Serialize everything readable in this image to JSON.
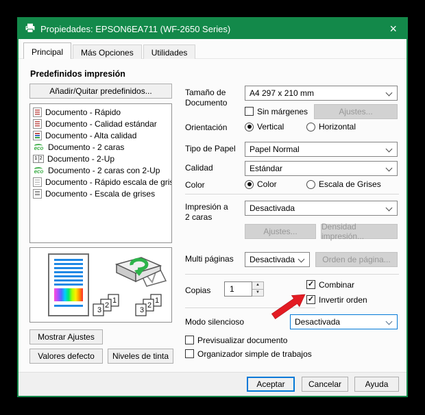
{
  "window": {
    "title": "Propiedades: EPSON6EA711 (WF-2650 Series)",
    "close_glyph": "×"
  },
  "tabs": [
    {
      "label": "Principal",
      "active": true
    },
    {
      "label": "Más Opciones",
      "active": false
    },
    {
      "label": "Utilidades",
      "active": false
    }
  ],
  "presets": {
    "heading": "Predefinidos impresión",
    "add_remove": "Añadir/Quitar predefinidos...",
    "items": [
      {
        "icon": "document-color-icon",
        "label": "Documento - Rápido"
      },
      {
        "icon": "document-color-icon",
        "label": "Documento - Calidad estándar"
      },
      {
        "icon": "document-multicolor-icon",
        "label": "Documento - Alta calidad"
      },
      {
        "icon": "eco-icon",
        "label": "Documento - 2 caras"
      },
      {
        "icon": "two-up-icon",
        "label": "Documento - 2-Up"
      },
      {
        "icon": "eco-icon",
        "label": "Documento - 2 caras con 2-Up"
      },
      {
        "icon": "document-gray-icon",
        "label": "Documento - Rápido escala de grises"
      },
      {
        "icon": "document-gray-icon",
        "label": "Documento - Escala de grises"
      }
    ],
    "show_settings": "Mostrar Ajustes",
    "defaults": "Valores defecto",
    "ink_levels": "Niveles de tinta"
  },
  "fields": {
    "size_label": "Tamaño de\nDocumento",
    "size_value": "A4 297 x 210 mm",
    "borderless_label": "Sin márgenes",
    "size_adjust": "Ajustes...",
    "orientation_label": "Orientación",
    "portrait": "Vertical",
    "landscape": "Horizontal",
    "paper_label": "Tipo de Papel",
    "paper_value": "Papel Normal",
    "quality_label": "Calidad",
    "quality_value": "Estándar",
    "color_label": "Color",
    "color_opt": "Color",
    "gray_opt": "Escala de Grises",
    "duplex_label": "Impresión a\n2 caras",
    "duplex_value": "Desactivada",
    "duplex_adjust": "Ajustes...",
    "density": "Densidad impresión...",
    "multipage_label": "Multi páginas",
    "multipage_value": "Desactivada",
    "page_order": "Orden de página...",
    "copies_label": "Copias",
    "copies_value": "1",
    "collate_label": "Combinar",
    "reverse_label": "Invertir orden",
    "quiet_label": "Modo silencioso",
    "quiet_value": "Desactivada",
    "preview_label": "Previsualizar documento",
    "organizer_label": "Organizador simple de trabajos"
  },
  "preview": {
    "stack_numbers": [
      "1",
      "2",
      "3"
    ]
  },
  "footer": {
    "ok": "Aceptar",
    "cancel": "Cancelar",
    "help": "Ayuda"
  },
  "colors": {
    "titlebar_green": "#13894a",
    "focus_blue": "#0078d7",
    "arrow_red": "#e31b23",
    "thumb_line_blue": "#1e88e5"
  }
}
